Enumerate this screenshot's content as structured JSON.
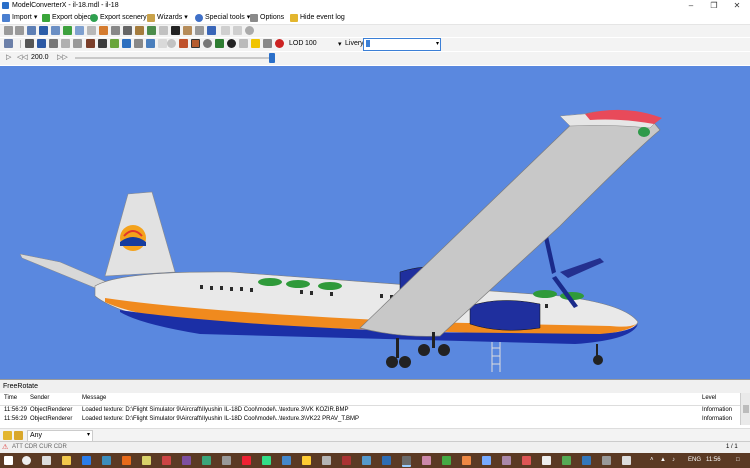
{
  "window": {
    "title": "ModelConverterX - il-18.mdl - il-18"
  },
  "menu": {
    "import": "Import",
    "export_object": "Export object",
    "export_scenery": "Export scenery",
    "wizards": "Wizards",
    "special_tools": "Special tools",
    "options": "Options",
    "hide_event_log": "Hide event log"
  },
  "toolbar3": {
    "lod_label": "LOD",
    "lod_value": "100",
    "livery_label": "Livery",
    "livery_value": ""
  },
  "toolbar4": {
    "time_value": "200.0"
  },
  "panel": {
    "title": "FreeRotate"
  },
  "log": {
    "columns": {
      "time": "Time",
      "sender": "Sender",
      "message": "Message",
      "level": "Level"
    },
    "rows": [
      {
        "time": "11:56:29",
        "sender": "ObjectRenderer",
        "message": "Loaded texture: D:\\Flight Simulator 9\\Aircraft\\Ilyushin IL-18D Cool\\model\\..\\texture.3\\VK KOZIR.BMP",
        "level": "Information"
      },
      {
        "time": "11:56:29",
        "sender": "ObjectRenderer",
        "message": "Loaded texture: D:\\Flight Simulator 9\\Aircraft\\Ilyushin IL-18D Cool\\model\\..\\texture.3\\VK22 PRAV_T.BMP",
        "level": "Information"
      }
    ],
    "filter_value": "Any"
  },
  "status": {
    "left": "ATT CDR  CUR CDR",
    "pages": "1 / 1"
  },
  "taskbar": {
    "lang": "ENG",
    "time": "11:56"
  },
  "colors": {
    "viewport_bg": "#5a88df",
    "taskbar_bg": "#5b3a24",
    "livery_border": "#3b7fd6"
  }
}
